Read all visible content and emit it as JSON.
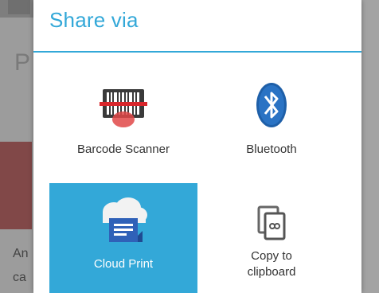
{
  "dialog": {
    "title": "Share via",
    "accent_color": "#33a8d8"
  },
  "targets": [
    {
      "label": "Barcode Scanner",
      "icon": "barcode-scanner-icon",
      "selected": false
    },
    {
      "label": "Bluetooth",
      "icon": "bluetooth-icon",
      "selected": false
    },
    {
      "label": "Cloud Print",
      "icon": "cloud-print-icon",
      "selected": true
    },
    {
      "label": "Copy to\nclipboard",
      "icon": "copy-clipboard-icon",
      "selected": false
    }
  ],
  "background": {
    "heading_fragment": "P",
    "text_fragment_1": "An",
    "text_fragment_2": "ca"
  }
}
